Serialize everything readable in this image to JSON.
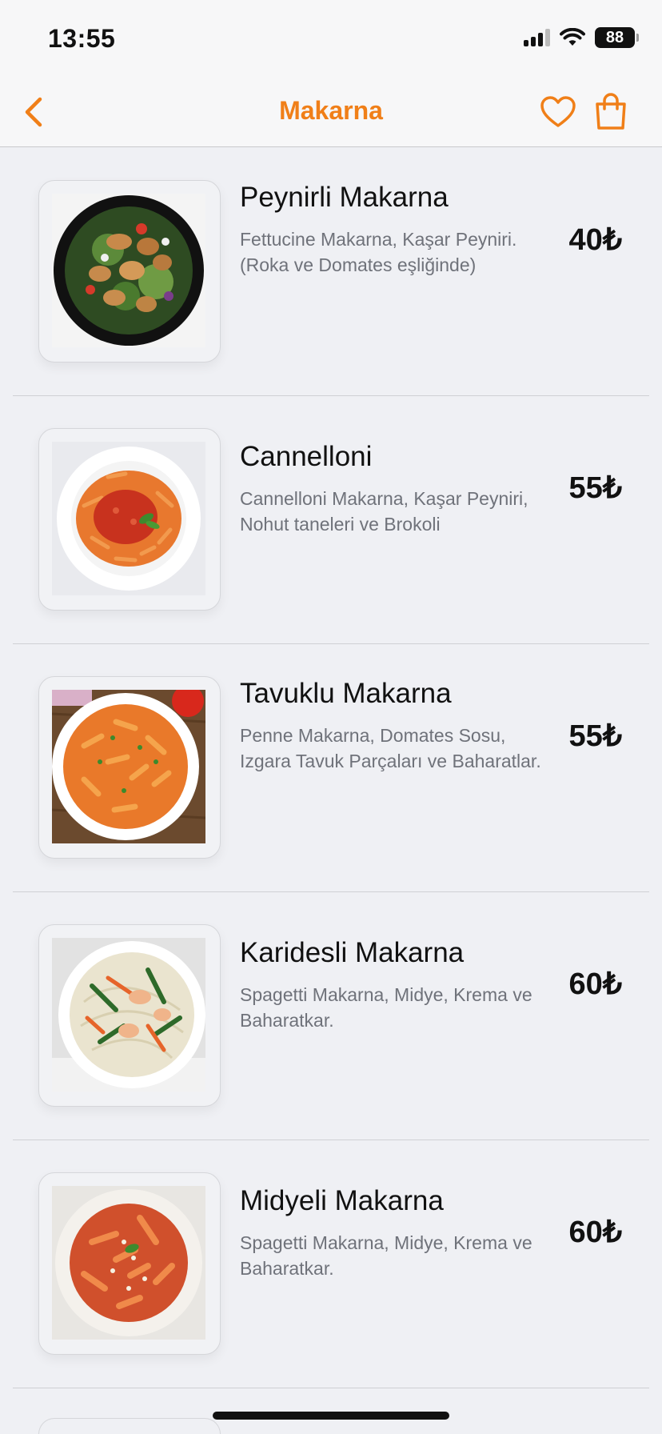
{
  "status_bar": {
    "time": "13:55",
    "battery": "88"
  },
  "nav": {
    "title": "Makarna",
    "back_icon": "chevron-left-icon",
    "favorite_icon": "heart-icon",
    "cart_icon": "shopping-bag-icon",
    "accent_color": "#f07f18"
  },
  "menu": {
    "items": [
      {
        "name": "Peynirli Makarna",
        "description": "Fettucine Makarna, Kaşar Peyniri. (Roka ve Domates eşliğinde)",
        "price": "40₺"
      },
      {
        "name": "Cannelloni",
        "description": "Cannelloni Makarna, Kaşar Peyniri, Nohut taneleri ve Brokoli",
        "price": "55₺"
      },
      {
        "name": "Tavuklu Makarna",
        "description": "Penne Makarna, Domates Sosu, Izgara Tavuk Parçaları ve Baharatlar.",
        "price": "55₺"
      },
      {
        "name": "Karidesli Makarna",
        "description": "Spagetti Makarna, Midye, Krema ve Baharatkar.",
        "price": "60₺"
      },
      {
        "name": "Midyeli Makarna",
        "description": "Spagetti Makarna, Midye, Krema ve Baharatkar.",
        "price": "60₺"
      }
    ]
  }
}
